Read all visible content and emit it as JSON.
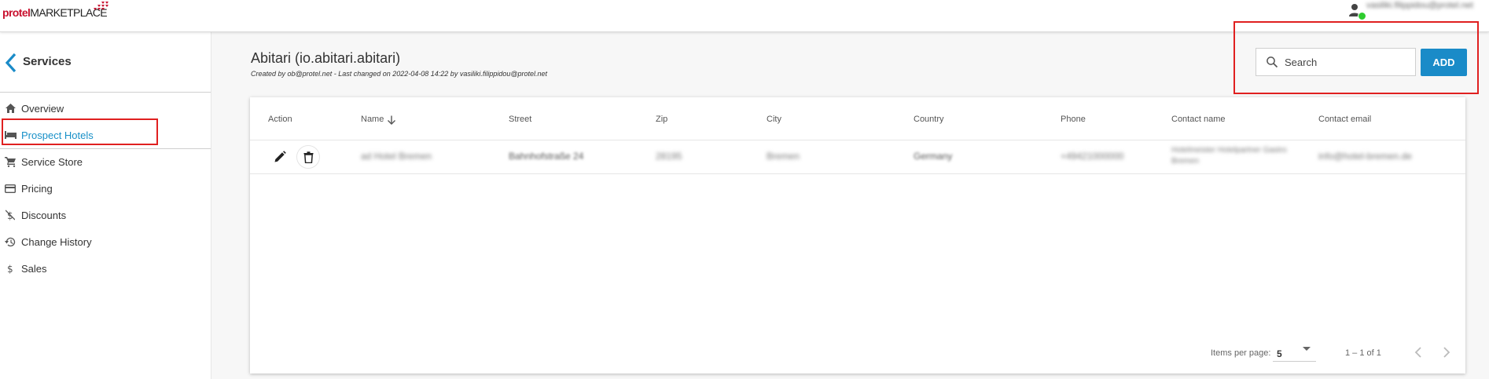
{
  "app": {
    "logo_part1": "protel",
    "logo_part2": "MARKETPLACE",
    "user_email": "vasiliki.filippidou@protel.net",
    "brand_red": "#c8102e",
    "accent_blue": "#1a8bc8",
    "status_green": "#2fcc2f"
  },
  "sidebar": {
    "back_icon": "chevron-left-icon",
    "title": "Services",
    "items": [
      {
        "label": "Overview",
        "icon": "home-icon"
      },
      {
        "label": "Prospect Hotels",
        "icon": "hotel-bed-icon",
        "active": true
      },
      {
        "label": "Service Store",
        "icon": "cart-icon"
      },
      {
        "label": "Pricing",
        "icon": "credit-card-icon"
      },
      {
        "label": "Discounts",
        "icon": "money-off-icon"
      },
      {
        "label": "Change History",
        "icon": "history-icon"
      },
      {
        "label": "Sales",
        "icon": "dollar-icon"
      }
    ]
  },
  "header": {
    "title": "Abitari (io.abitari.abitari)",
    "subtitle": "Created by ob@protel.net - Last changed on 2022-04-08 14:22 by vasiliki.filippidou@protel.net"
  },
  "search": {
    "placeholder": "Search",
    "value": ""
  },
  "toolbar": {
    "add_label": "ADD"
  },
  "table": {
    "columns": [
      "Action",
      "Name",
      "Street",
      "Zip",
      "City",
      "Country",
      "Phone",
      "Contact name",
      "Contact email"
    ],
    "sort_column": "Name",
    "sort_direction": "desc",
    "rows": [
      {
        "name": "ad Hotel Bremen",
        "street": "Bahnhofstraße 24",
        "zip": "28195",
        "city": "Bremen",
        "country": "Germany",
        "phone": "+49421000000",
        "contact_name_1": "Hotelmeister Hotelpartner Gastro",
        "contact_name_2": "Bremen",
        "contact_email": "info@hotel-bremen.de"
      }
    ]
  },
  "paginator": {
    "items_per_page_label": "Items per page:",
    "items_per_page": "5",
    "range_label": "1 – 1 of 1"
  }
}
